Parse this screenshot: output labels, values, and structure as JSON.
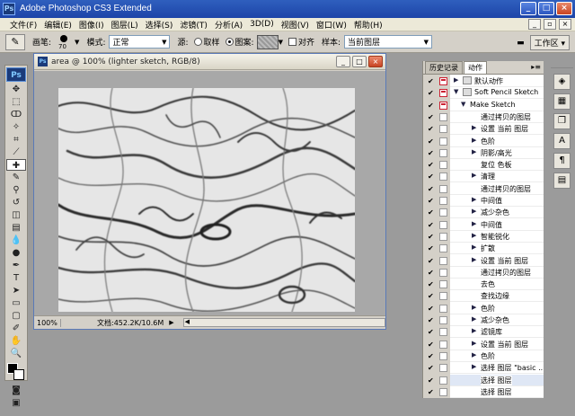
{
  "app": {
    "title": "Adobe Photoshop CS3 Extended",
    "logo": "Ps",
    "window_buttons": [
      "_",
      "□",
      "×"
    ]
  },
  "menu": [
    "文件(F)",
    "编辑(E)",
    "图像(I)",
    "图层(L)",
    "选择(S)",
    "滤镜(T)",
    "分析(A)",
    "3D(D)",
    "视图(V)",
    "窗口(W)",
    "帮助(H)"
  ],
  "options": {
    "brush_label": "画笔:",
    "brush_size": "70",
    "mode_label": "模式:",
    "mode_value": "正常",
    "source_label": "源:",
    "sampled_label": "取样",
    "pattern_label": "图案:",
    "aligned_label": "对齐",
    "sample_label": "样本:",
    "sample_value": "当前图层",
    "workspace_label": "工作区"
  },
  "document": {
    "title": "area @ 100% (lighter sketch, RGB/8)",
    "zoom": "100%",
    "doc_info": "文档:452.2K/10.6M"
  },
  "panel": {
    "tabs": [
      "历史记录",
      "动作"
    ],
    "active_tab": "动作",
    "rows": [
      {
        "text": "默认动作",
        "level": 0,
        "kind": "set",
        "check": "✔",
        "dlg": "red",
        "tri": "▶"
      },
      {
        "text": "Soft Pencil Sketch",
        "level": 0,
        "kind": "set",
        "check": "✔",
        "dlg": "red",
        "tri": "▼"
      },
      {
        "text": "Make Sketch",
        "level": 1,
        "kind": "action",
        "check": "✔",
        "dlg": "red",
        "tri": "▼"
      },
      {
        "text": "通过拷贝的图层",
        "level": 2,
        "kind": "step",
        "check": "✔",
        "dlg": "",
        "tri": ""
      },
      {
        "text": "设置 当前 图层",
        "level": 2,
        "kind": "step",
        "check": "✔",
        "dlg": "",
        "tri": "▶"
      },
      {
        "text": "色阶",
        "level": 2,
        "kind": "step",
        "check": "✔",
        "dlg": "",
        "tri": "▶"
      },
      {
        "text": "阴影/高光",
        "level": 2,
        "kind": "step",
        "check": "✔",
        "dlg": "",
        "tri": "▶"
      },
      {
        "text": "复位 色板",
        "level": 2,
        "kind": "step",
        "check": "✔",
        "dlg": "",
        "tri": ""
      },
      {
        "text": "清理",
        "level": 2,
        "kind": "step",
        "check": "✔",
        "dlg": "",
        "tri": "▶"
      },
      {
        "text": "通过拷贝的图层",
        "level": 2,
        "kind": "step",
        "check": "✔",
        "dlg": "",
        "tri": ""
      },
      {
        "text": "中间值",
        "level": 2,
        "kind": "step",
        "check": "✔",
        "dlg": "",
        "tri": "▶"
      },
      {
        "text": "减少杂色",
        "level": 2,
        "kind": "step",
        "check": "✔",
        "dlg": "",
        "tri": "▶"
      },
      {
        "text": "中间值",
        "level": 2,
        "kind": "step",
        "check": "✔",
        "dlg": "",
        "tri": "▶"
      },
      {
        "text": "智能锐化",
        "level": 2,
        "kind": "step",
        "check": "✔",
        "dlg": "",
        "tri": "▶"
      },
      {
        "text": "扩散",
        "level": 2,
        "kind": "step",
        "check": "✔",
        "dlg": "",
        "tri": "▶"
      },
      {
        "text": "设置 当前 图层",
        "level": 2,
        "kind": "step",
        "check": "✔",
        "dlg": "",
        "tri": "▶"
      },
      {
        "text": "通过拷贝的图层",
        "level": 2,
        "kind": "step",
        "check": "✔",
        "dlg": "",
        "tri": ""
      },
      {
        "text": "去色",
        "level": 2,
        "kind": "step",
        "check": "✔",
        "dlg": "",
        "tri": ""
      },
      {
        "text": "查找边缘",
        "level": 2,
        "kind": "step",
        "check": "✔",
        "dlg": "",
        "tri": ""
      },
      {
        "text": "色阶",
        "level": 2,
        "kind": "step",
        "check": "✔",
        "dlg": "",
        "tri": "▶"
      },
      {
        "text": "减少杂色",
        "level": 2,
        "kind": "step",
        "check": "✔",
        "dlg": "",
        "tri": "▶"
      },
      {
        "text": "滤镜库",
        "level": 2,
        "kind": "step",
        "check": "✔",
        "dlg": "",
        "tri": "▶"
      },
      {
        "text": "设置 当前 图层",
        "level": 2,
        "kind": "step",
        "check": "✔",
        "dlg": "",
        "tri": "▶"
      },
      {
        "text": "色阶",
        "level": 2,
        "kind": "step",
        "check": "✔",
        "dlg": "",
        "tri": "▶"
      },
      {
        "text": "选择 图层 \"basic ...",
        "level": 2,
        "kind": "step",
        "check": "✔",
        "dlg": "",
        "tri": "▶"
      },
      {
        "text": "选择 图层",
        "level": 2,
        "kind": "step",
        "check": "✔",
        "dlg": "",
        "tri": "",
        "selected": true
      },
      {
        "text": "选择 图层",
        "level": 2,
        "kind": "step",
        "check": "✔",
        "dlg": "",
        "tri": ""
      }
    ]
  },
  "colors": {
    "titlebar": "#2f5fbe",
    "menubar": "#ece9d8",
    "workspace": "#9b9b9b",
    "panel_bg": "#d4d0c8"
  }
}
